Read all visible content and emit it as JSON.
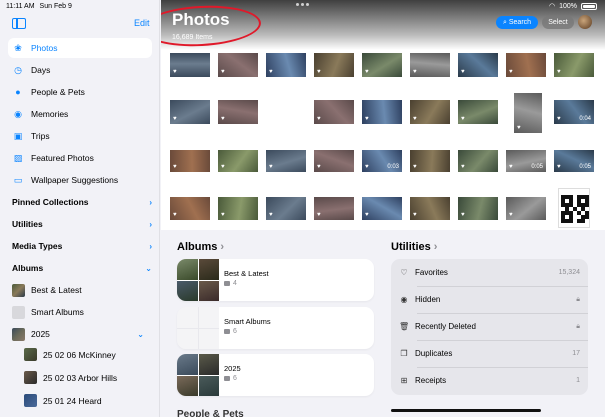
{
  "status": {
    "time": "11:11 AM",
    "date": "Sun Feb 9",
    "battery": "100%"
  },
  "sidebar": {
    "edit_label": "Edit",
    "items": [
      {
        "label": "Photos",
        "icon": "photos-icon"
      },
      {
        "label": "Days",
        "icon": "clock-icon"
      },
      {
        "label": "People & Pets",
        "icon": "person-icon"
      },
      {
        "label": "Memories",
        "icon": "memories-icon"
      },
      {
        "label": "Trips",
        "icon": "suitcase-icon"
      },
      {
        "label": "Featured Photos",
        "icon": "featured-icon"
      },
      {
        "label": "Wallpaper Suggestions",
        "icon": "wallpaper-icon"
      }
    ],
    "sections": [
      "Pinned Collections",
      "Utilities",
      "Media Types",
      "Albums"
    ],
    "albums": [
      "Best & Latest",
      "Smart Albums",
      "2025"
    ],
    "sub_albums": [
      "25 02 06 McKinney",
      "25 02 03 Arbor Hills",
      "25 01 24 Heard"
    ]
  },
  "header": {
    "title": "Photos",
    "count": "16,689 Items",
    "search_label": "Search",
    "select_label": "Select"
  },
  "photo_durations": [
    "0:04",
    "0:03",
    "0:05",
    "0:05"
  ],
  "albums_section": {
    "title": "Albums",
    "cards": [
      {
        "name": "Best & Latest",
        "count": "4"
      },
      {
        "name": "Smart Albums",
        "count": "6"
      },
      {
        "name": "2025",
        "count": "6"
      }
    ]
  },
  "utilities_section": {
    "title": "Utilities",
    "rows": [
      {
        "label": "Favorites",
        "value": "15,324",
        "icon": "heart-icon"
      },
      {
        "label": "Hidden",
        "value": "",
        "icon": "eye-icon"
      },
      {
        "label": "Recently Deleted",
        "value": "",
        "icon": "trash-icon"
      },
      {
        "label": "Duplicates",
        "value": "17",
        "icon": "duplicate-icon"
      },
      {
        "label": "Receipts",
        "value": "1",
        "icon": "cart-icon"
      }
    ]
  },
  "bottom_section_title": "People & Pets",
  "colors": {
    "accent": "#0a84ff",
    "annotation": "#e0192a"
  }
}
